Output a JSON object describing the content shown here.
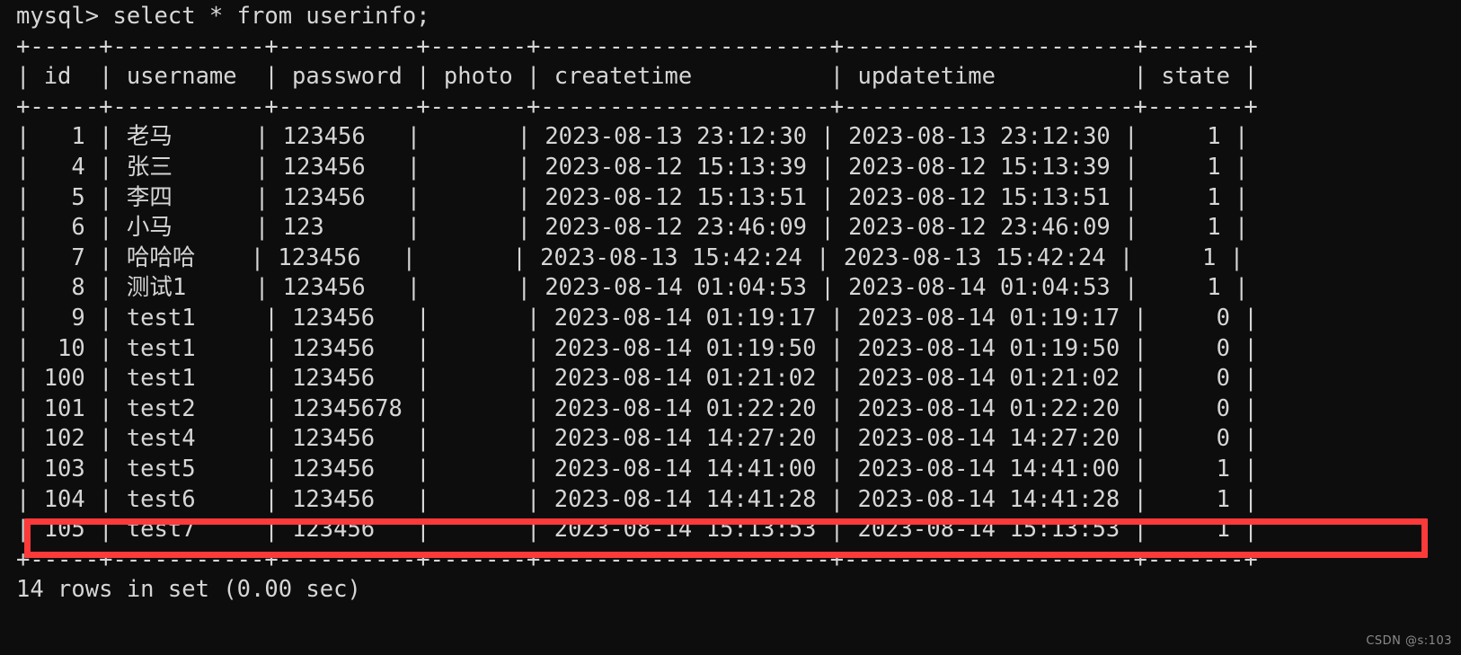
{
  "terminal": {
    "prompt": "mysql> ",
    "command": "select * from userinfo;",
    "background_color": "#0d0d0d",
    "text_color": "#d6d6d6",
    "highlight_color": "#fc3a3a"
  },
  "table": {
    "columns": [
      {
        "name": "id",
        "width": 5,
        "align": "right"
      },
      {
        "name": "username",
        "width": 11,
        "align": "left"
      },
      {
        "name": "password",
        "width": 10,
        "align": "left"
      },
      {
        "name": "photo",
        "width": 7,
        "align": "left"
      },
      {
        "name": "createtime",
        "width": 21,
        "align": "left"
      },
      {
        "name": "updatetime",
        "width": 21,
        "align": "left"
      },
      {
        "name": "state",
        "width": 7,
        "align": "right"
      }
    ],
    "rows": [
      {
        "id": "1",
        "username": "老马",
        "password": "123456",
        "photo": "",
        "createtime": "2023-08-13 23:12:30",
        "updatetime": "2023-08-13 23:12:30",
        "state": "1",
        "highlighted": false
      },
      {
        "id": "4",
        "username": "张三",
        "password": "123456",
        "photo": "",
        "createtime": "2023-08-12 15:13:39",
        "updatetime": "2023-08-12 15:13:39",
        "state": "1",
        "highlighted": false
      },
      {
        "id": "5",
        "username": "李四",
        "password": "123456",
        "photo": "",
        "createtime": "2023-08-12 15:13:51",
        "updatetime": "2023-08-12 15:13:51",
        "state": "1",
        "highlighted": false
      },
      {
        "id": "6",
        "username": "小马",
        "password": "123",
        "photo": "",
        "createtime": "2023-08-12 23:46:09",
        "updatetime": "2023-08-12 23:46:09",
        "state": "1",
        "highlighted": false
      },
      {
        "id": "7",
        "username": "哈哈哈",
        "password": "123456",
        "photo": "",
        "createtime": "2023-08-13 15:42:24",
        "updatetime": "2023-08-13 15:42:24",
        "state": "1",
        "highlighted": false
      },
      {
        "id": "8",
        "username": "测试1",
        "password": "123456",
        "photo": "",
        "createtime": "2023-08-14 01:04:53",
        "updatetime": "2023-08-14 01:04:53",
        "state": "1",
        "highlighted": false
      },
      {
        "id": "9",
        "username": "test1",
        "password": "123456",
        "photo": "",
        "createtime": "2023-08-14 01:19:17",
        "updatetime": "2023-08-14 01:19:17",
        "state": "0",
        "highlighted": false
      },
      {
        "id": "10",
        "username": "test1",
        "password": "123456",
        "photo": "",
        "createtime": "2023-08-14 01:19:50",
        "updatetime": "2023-08-14 01:19:50",
        "state": "0",
        "highlighted": false
      },
      {
        "id": "100",
        "username": "test1",
        "password": "123456",
        "photo": "",
        "createtime": "2023-08-14 01:21:02",
        "updatetime": "2023-08-14 01:21:02",
        "state": "0",
        "highlighted": false
      },
      {
        "id": "101",
        "username": "test2",
        "password": "12345678",
        "photo": "",
        "createtime": "2023-08-14 01:22:20",
        "updatetime": "2023-08-14 01:22:20",
        "state": "0",
        "highlighted": false
      },
      {
        "id": "102",
        "username": "test4",
        "password": "123456",
        "photo": "",
        "createtime": "2023-08-14 14:27:20",
        "updatetime": "2023-08-14 14:27:20",
        "state": "0",
        "highlighted": false
      },
      {
        "id": "103",
        "username": "test5",
        "password": "123456",
        "photo": "",
        "createtime": "2023-08-14 14:41:00",
        "updatetime": "2023-08-14 14:41:00",
        "state": "1",
        "highlighted": false
      },
      {
        "id": "104",
        "username": "test6",
        "password": "123456",
        "photo": "",
        "createtime": "2023-08-14 14:41:28",
        "updatetime": "2023-08-14 14:41:28",
        "state": "1",
        "highlighted": false
      },
      {
        "id": "105",
        "username": "test7",
        "password": "123456",
        "photo": "",
        "createtime": "2023-08-14 15:13:53",
        "updatetime": "2023-08-14 15:13:53",
        "state": "1",
        "highlighted": true
      }
    ]
  },
  "status": {
    "result_line": "14 rows in set (0.00 sec)",
    "row_count": 14,
    "elapsed": "0.00 sec"
  },
  "watermark": {
    "text": "CSDN @s:103"
  }
}
